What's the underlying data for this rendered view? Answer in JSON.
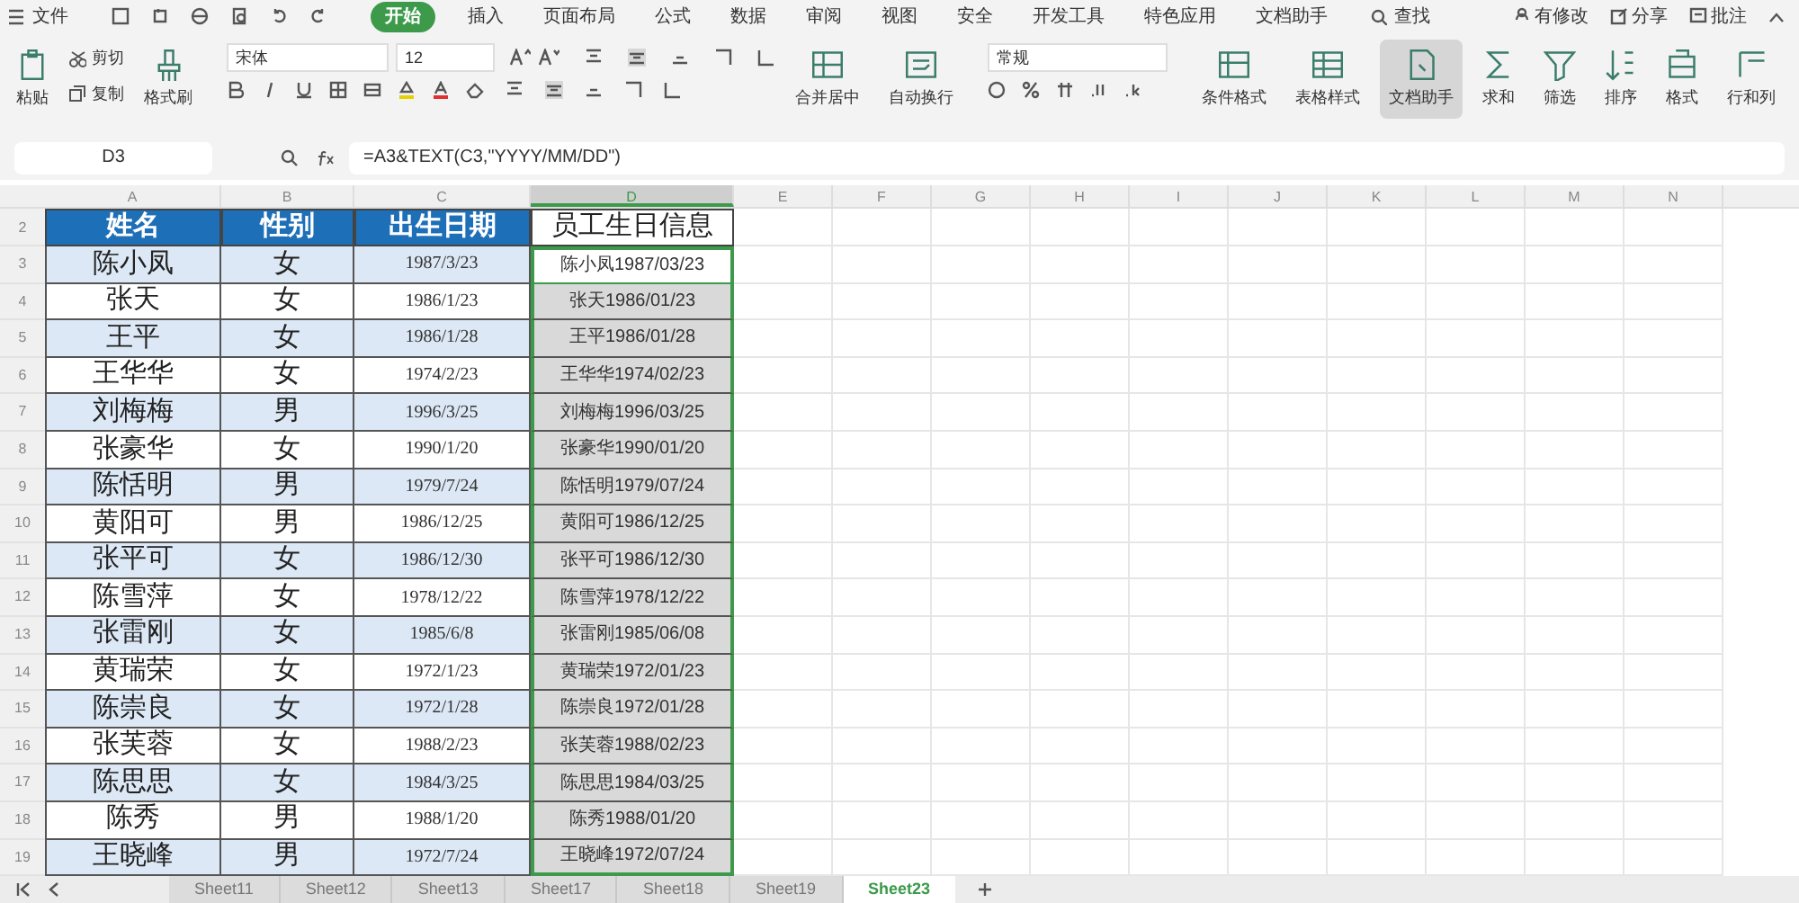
{
  "menu": {
    "file": "文件",
    "tabs": [
      {
        "label": "开始",
        "selected": true
      },
      {
        "label": "插入",
        "selected": false
      },
      {
        "label": "页面布局",
        "selected": false
      },
      {
        "label": "公式",
        "selected": false
      },
      {
        "label": "数据",
        "selected": false
      },
      {
        "label": "审阅",
        "selected": false
      },
      {
        "label": "视图",
        "selected": false
      },
      {
        "label": "安全",
        "selected": false
      },
      {
        "label": "开发工具",
        "selected": false
      },
      {
        "label": "特色应用",
        "selected": false
      },
      {
        "label": "文档助手",
        "selected": false
      }
    ],
    "search": "查找",
    "right": [
      "有修改",
      "分享",
      "批注"
    ]
  },
  "toolbar": [
    {
      "kind": "big",
      "label": "粘贴",
      "selected": false
    },
    {
      "kind": "pair",
      "labels": [
        "剪切",
        "复制"
      ]
    },
    {
      "kind": "big",
      "label": "格式刷",
      "selected": false
    },
    {
      "kind": "font",
      "font": "宋体",
      "size": "12"
    },
    {
      "kind": "big",
      "label": "合并居中",
      "selected": false
    },
    {
      "kind": "big",
      "label": "自动换行",
      "selected": false
    },
    {
      "kind": "numfmt",
      "value": "常规"
    },
    {
      "kind": "big",
      "label": "条件格式",
      "selected": false
    },
    {
      "kind": "big",
      "label": "表格样式",
      "selected": false
    },
    {
      "kind": "big",
      "label": "文档助手",
      "selected": true
    },
    {
      "kind": "big",
      "label": "求和",
      "selected": false
    },
    {
      "kind": "big",
      "label": "筛选",
      "selected": false
    },
    {
      "kind": "big",
      "label": "排序",
      "selected": false
    },
    {
      "kind": "big",
      "label": "格式",
      "selected": false
    },
    {
      "kind": "big",
      "label": "行和列",
      "selected": false
    }
  ],
  "name_box": "D3",
  "formula": "=A3&TEXT(C3,\"YYYY/MM/DD\")",
  "columns": [
    {
      "label": "A",
      "selected": false
    },
    {
      "label": "B",
      "selected": false
    },
    {
      "label": "C",
      "selected": false
    },
    {
      "label": "D",
      "selected": true
    },
    {
      "label": "E",
      "selected": false
    },
    {
      "label": "F",
      "selected": false
    },
    {
      "label": "G",
      "selected": false
    },
    {
      "label": "H",
      "selected": false
    },
    {
      "label": "I",
      "selected": false
    },
    {
      "label": "J",
      "selected": false
    },
    {
      "label": "K",
      "selected": false
    },
    {
      "label": "L",
      "selected": false
    },
    {
      "label": "M",
      "selected": false
    },
    {
      "label": "N",
      "selected": false
    }
  ],
  "header_row": {
    "num": "2",
    "cells": [
      "姓名",
      "性别",
      "出生日期",
      "员工生日信息"
    ]
  },
  "rows": [
    {
      "num": "3",
      "name": "陈小凤",
      "gender": "女",
      "birth": "1987/3/23",
      "info": "陈小凤1987/03/23",
      "active": true
    },
    {
      "num": "4",
      "name": "张天",
      "gender": "女",
      "birth": "1986/1/23",
      "info": "张天1986/01/23",
      "active": false
    },
    {
      "num": "5",
      "name": "王平",
      "gender": "女",
      "birth": "1986/1/28",
      "info": "王平1986/01/28",
      "active": false
    },
    {
      "num": "6",
      "name": "王华华",
      "gender": "女",
      "birth": "1974/2/23",
      "info": "王华华1974/02/23",
      "active": false
    },
    {
      "num": "7",
      "name": "刘梅梅",
      "gender": "男",
      "birth": "1996/3/25",
      "info": "刘梅梅1996/03/25",
      "active": false
    },
    {
      "num": "8",
      "name": "张豪华",
      "gender": "女",
      "birth": "1990/1/20",
      "info": "张豪华1990/01/20",
      "active": false
    },
    {
      "num": "9",
      "name": "陈恬明",
      "gender": "男",
      "birth": "1979/7/24",
      "info": "陈恬明1979/07/24",
      "active": false
    },
    {
      "num": "10",
      "name": "黄阳可",
      "gender": "男",
      "birth": "1986/12/25",
      "info": "黄阳可1986/12/25",
      "active": false
    },
    {
      "num": "11",
      "name": "张平可",
      "gender": "女",
      "birth": "1986/12/30",
      "info": "张平可1986/12/30",
      "active": false
    },
    {
      "num": "12",
      "name": "陈雪萍",
      "gender": "女",
      "birth": "1978/12/22",
      "info": "陈雪萍1978/12/22",
      "active": false
    },
    {
      "num": "13",
      "name": "张雷刚",
      "gender": "女",
      "birth": "1985/6/8",
      "info": "张雷刚1985/06/08",
      "active": false
    },
    {
      "num": "14",
      "name": "黄瑞荣",
      "gender": "女",
      "birth": "1972/1/23",
      "info": "黄瑞荣1972/01/23",
      "active": false
    },
    {
      "num": "15",
      "name": "陈崇良",
      "gender": "女",
      "birth": "1972/1/28",
      "info": "陈崇良1972/01/28",
      "active": false
    },
    {
      "num": "16",
      "name": "张芙蓉",
      "gender": "女",
      "birth": "1988/2/23",
      "info": "张芙蓉1988/02/23",
      "active": false
    },
    {
      "num": "17",
      "name": "陈思思",
      "gender": "女",
      "birth": "1984/3/25",
      "info": "陈思思1984/03/25",
      "active": false
    },
    {
      "num": "18",
      "name": "陈秀",
      "gender": "男",
      "birth": "1988/1/20",
      "info": "陈秀1988/01/20",
      "active": false
    },
    {
      "num": "19",
      "name": "王晓峰",
      "gender": "男",
      "birth": "1972/7/24",
      "info": "王晓峰1972/07/24",
      "active": false
    }
  ],
  "sheet_tabs": [
    {
      "label": "Sheet11",
      "selected": false
    },
    {
      "label": "Sheet12",
      "selected": false
    },
    {
      "label": "Sheet13",
      "selected": false
    },
    {
      "label": "Sheet17",
      "selected": false
    },
    {
      "label": "Sheet18",
      "selected": false
    },
    {
      "label": "Sheet19",
      "selected": false
    },
    {
      "label": "Sheet23",
      "selected": true
    }
  ]
}
